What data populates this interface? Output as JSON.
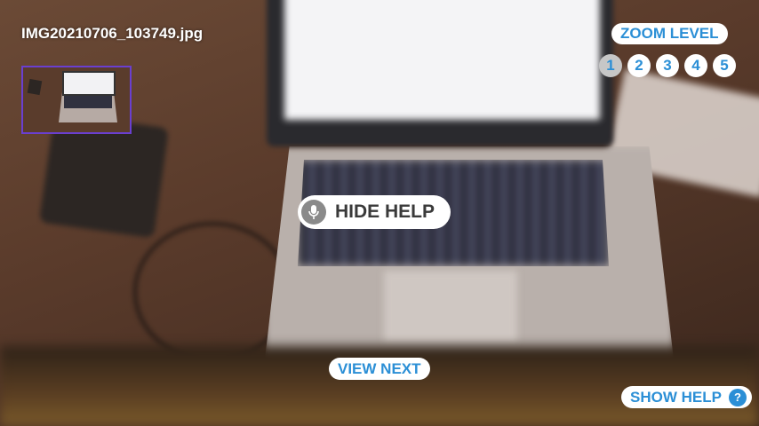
{
  "file": {
    "name": "IMG20210706_103749.jpg"
  },
  "zoom": {
    "label": "ZOOM LEVEL",
    "levels": [
      "1",
      "2",
      "3",
      "4",
      "5"
    ],
    "selected": "1"
  },
  "help": {
    "hide_label": "HIDE HELP",
    "show_label": "SHOW HELP",
    "show_icon_glyph": "?",
    "mic_icon": "microphone-icon",
    "help_icon": "question-icon"
  },
  "navigation": {
    "view_next_label": "VIEW NEXT"
  },
  "colors": {
    "accent": "#2b8fd6",
    "thumbnail_border": "#6a3fd0",
    "selected_zoom_bg": "#c7c7c7",
    "pill_bg": "#ffffff"
  }
}
